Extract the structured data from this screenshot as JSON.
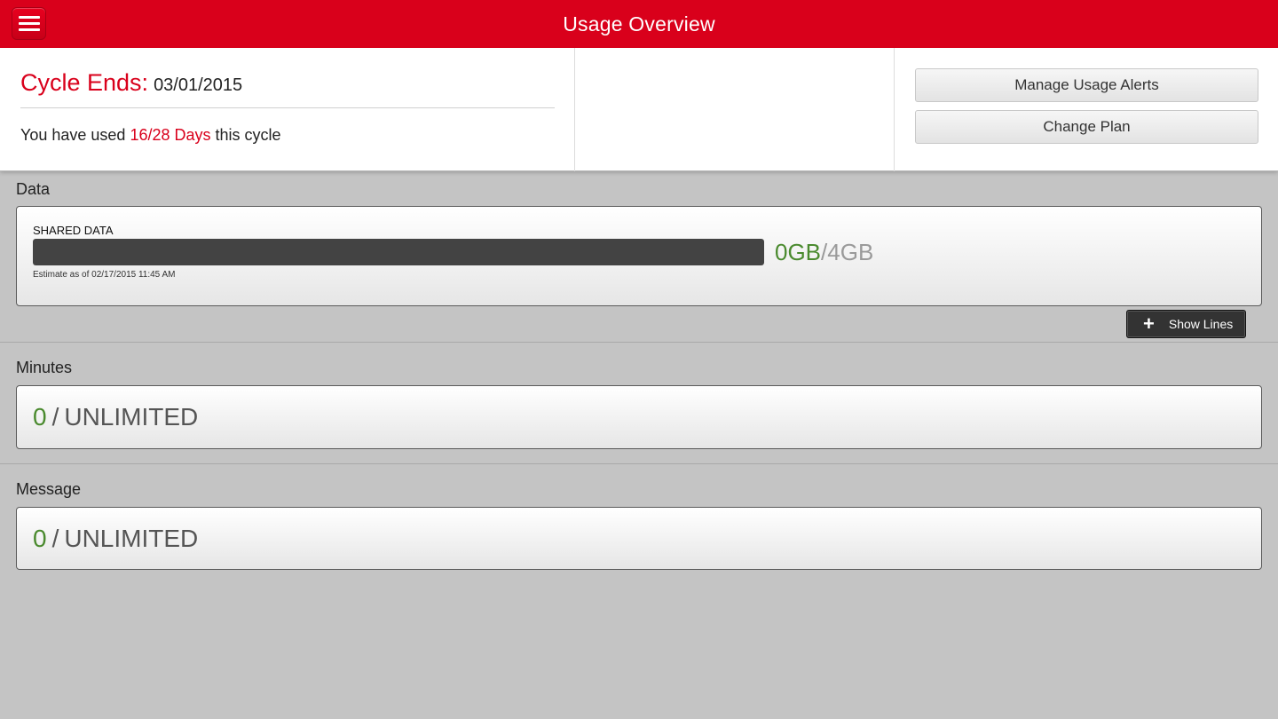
{
  "header": {
    "title": "Usage Overview",
    "menu_icon": "hamburger-menu-icon"
  },
  "summary": {
    "cycle_label": "Cycle Ends:",
    "cycle_date": "03/01/2015",
    "usage_prefix": "You have used",
    "usage_days": "16/28 Days",
    "usage_suffix": "this cycle",
    "manage_alerts_label": "Manage Usage Alerts",
    "change_plan_label": "Change Plan"
  },
  "data_section": {
    "title": "Data",
    "shared_label": "SHARED DATA",
    "used": "0GB",
    "separator": "/",
    "total": "4GB",
    "used_fraction": 0,
    "estimate": "Estimate as of 02/17/2015 11:45 AM",
    "show_lines_label": "Show Lines",
    "show_lines_icon": "plus-icon"
  },
  "minutes_section": {
    "title": "Minutes",
    "used": "0",
    "separator": "/",
    "limit": "UNLIMITED"
  },
  "message_section": {
    "title": "Message",
    "used": "0",
    "separator": "/",
    "limit": "UNLIMITED"
  },
  "colors": {
    "brand_red": "#d9001b",
    "used_green": "#4a8a2e",
    "bar_dark": "#434343"
  }
}
